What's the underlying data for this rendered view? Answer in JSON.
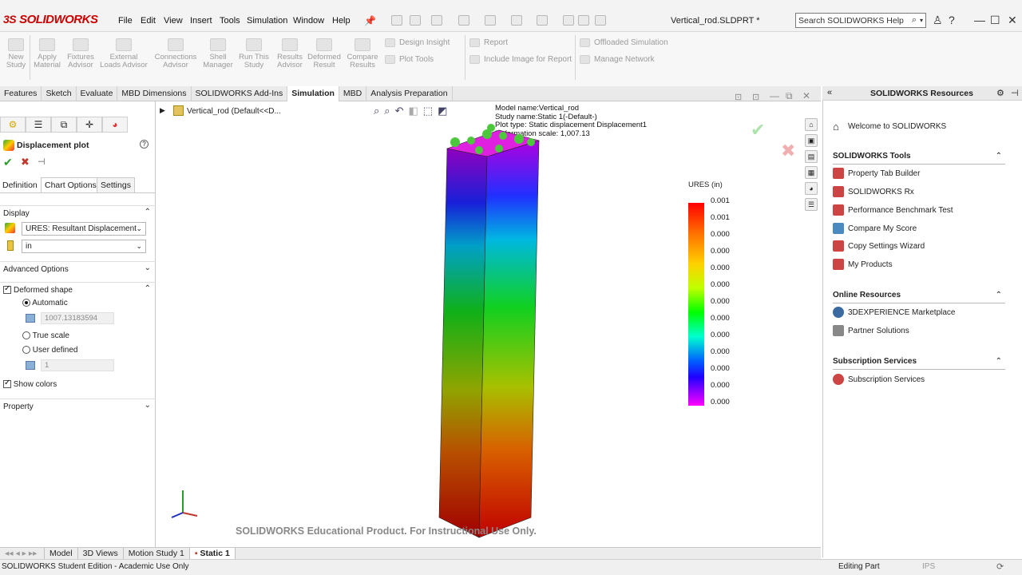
{
  "app": {
    "brand": "SOLIDWORKS",
    "doc_title": "Vertical_rod.SLDPRT *",
    "search_placeholder": "Search SOLIDWORKS Help"
  },
  "menu": [
    "File",
    "Edit",
    "View",
    "Insert",
    "Tools",
    "Simulation",
    "Window",
    "Help"
  ],
  "command_manager": {
    "big_buttons": [
      {
        "label": "New Study",
        "icon": "new-study-icon"
      },
      {
        "label": "Apply Material",
        "icon": "apply-material-icon"
      },
      {
        "label": "Fixtures Advisor",
        "icon": "fixtures-icon"
      },
      {
        "label": "External Loads Advisor",
        "icon": "loads-icon"
      },
      {
        "label": "Connections Advisor",
        "icon": "connections-icon"
      },
      {
        "label": "Shell Manager",
        "icon": "shell-icon"
      },
      {
        "label": "Run This Study",
        "icon": "run-icon"
      },
      {
        "label": "Results Advisor",
        "icon": "results-icon"
      },
      {
        "label": "Deformed Result",
        "icon": "deformed-icon"
      },
      {
        "label": "Compare Results",
        "icon": "compare-icon"
      }
    ],
    "row_buttons": {
      "design_insight": "Design Insight",
      "plot_tools": "Plot Tools",
      "report": "Report",
      "include_image": "Include Image for Report",
      "offloaded": "Offloaded Simulation",
      "manage_network": "Manage Network"
    }
  },
  "tabs": [
    {
      "label": "Features",
      "active": false
    },
    {
      "label": "Sketch",
      "active": false
    },
    {
      "label": "Evaluate",
      "active": false
    },
    {
      "label": "MBD Dimensions",
      "active": false
    },
    {
      "label": "SOLIDWORKS Add-Ins",
      "active": false
    },
    {
      "label": "Simulation",
      "active": true
    },
    {
      "label": "MBD",
      "active": false
    },
    {
      "label": "Analysis Preparation",
      "active": false
    }
  ],
  "pm": {
    "title": "Displacement plot",
    "subtabs": [
      "Definition",
      "Chart Options",
      "Settings"
    ],
    "display_heading": "Display",
    "component": "URES:  Resultant Displacement",
    "units": "in",
    "advanced_heading": "Advanced Options",
    "deformed_heading": "Deformed shape",
    "automatic": "Automatic",
    "scale_value": "1007.13183594",
    "true_scale": "True scale",
    "user_defined": "User defined",
    "user_value": "1",
    "show_colors": "Show colors",
    "property_heading": "Property"
  },
  "graphics": {
    "tree_node": "Vertical_rod  (Default<<D...",
    "info": {
      "model_name": "Model name:Vertical_rod",
      "study_name": "Study name:Static 1(-Default-)",
      "plot_type": "Plot type: Static displacement Displacement1",
      "deformation": "Deformation scale: 1,007.13"
    },
    "watermark": "SOLIDWORKS Educational Product. For Instructional Use Only.",
    "legend_title": "URES (in)",
    "legend_values": [
      "0.001",
      "0.001",
      "0.000",
      "0.000",
      "0.000",
      "0.000",
      "0.000",
      "0.000",
      "0.000",
      "0.000",
      "0.000",
      "0.000",
      "0.000"
    ]
  },
  "resources": {
    "title": "SOLIDWORKS Resources",
    "welcome": "Welcome to SOLIDWORKS",
    "tools_heading": "SOLIDWORKS Tools",
    "tools": [
      "Property Tab Builder",
      "SOLIDWORKS Rx",
      "Performance Benchmark Test",
      "Compare My Score",
      "Copy Settings Wizard",
      "My Products"
    ],
    "online_heading": "Online Resources",
    "online": [
      "3DEXPERIENCE Marketplace",
      "Partner Solutions"
    ],
    "subscription_heading": "Subscription Services",
    "subscription": [
      "Subscription Services"
    ]
  },
  "bottom_tabs": [
    {
      "label": "Model",
      "active": false
    },
    {
      "label": "3D Views",
      "active": false
    },
    {
      "label": "Motion Study 1",
      "active": false
    },
    {
      "label": "Static 1",
      "active": true
    }
  ],
  "status": {
    "left": "SOLIDWORKS Student Edition - Academic Use Only",
    "mode": "Editing Part",
    "units": "IPS"
  },
  "colors": {
    "brand_red": "#cc0000",
    "accept_green": "#2a9d2a",
    "cancel_red": "#c0392b"
  }
}
